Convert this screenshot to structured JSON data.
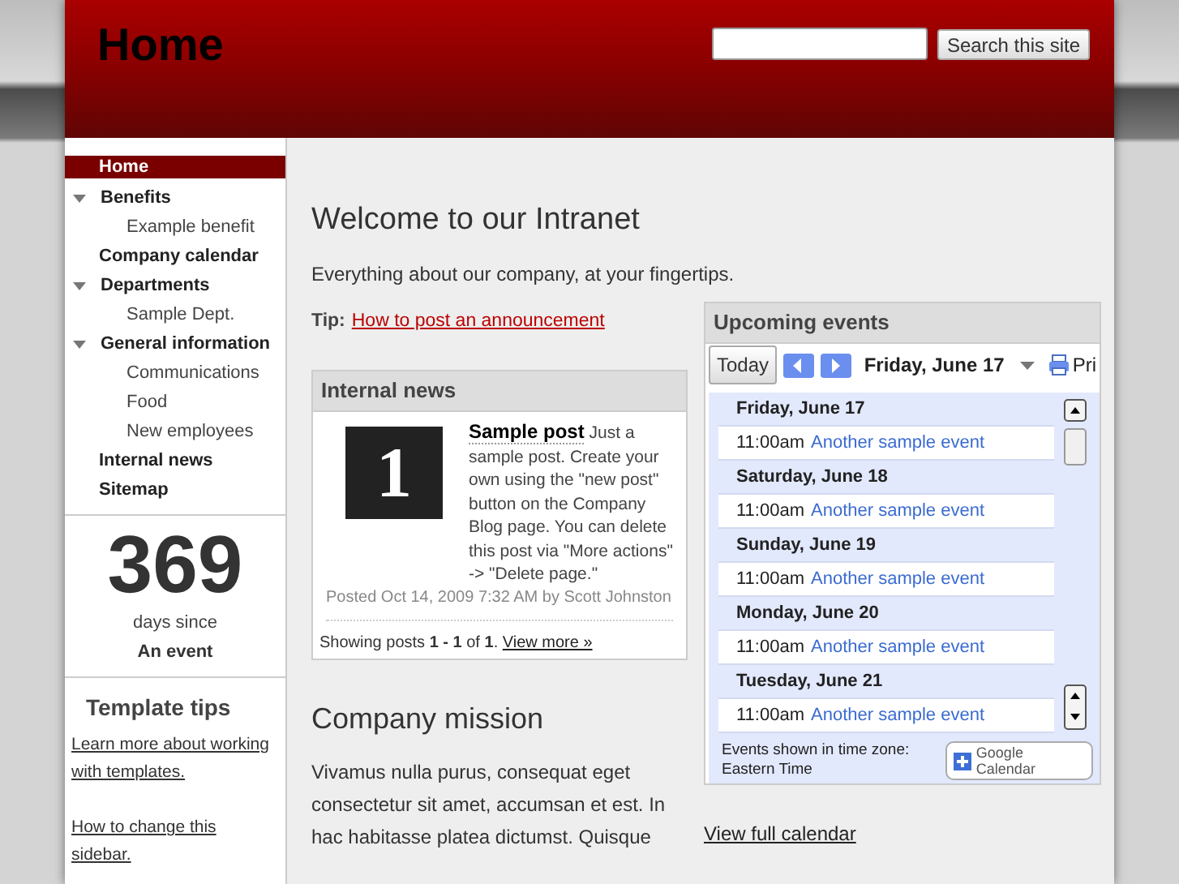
{
  "header": {
    "title": "Home",
    "search_button": "Search this site"
  },
  "sidebar": {
    "nav": [
      {
        "label": "Home",
        "selected": true
      },
      {
        "label": "Benefits",
        "selected": false,
        "expanded": true,
        "children": [
          {
            "label": "Example benefit",
            "selected": false
          }
        ]
      },
      {
        "label": "Company calendar",
        "selected": false
      },
      {
        "label": "Departments",
        "selected": false,
        "expanded": true,
        "children": [
          {
            "label": "Sample Dept.",
            "selected": false
          }
        ]
      },
      {
        "label": "General information",
        "selected": false,
        "expanded": true,
        "children": [
          {
            "label": "Communications",
            "selected": false
          },
          {
            "label": "Food",
            "selected": false
          },
          {
            "label": "New employees",
            "selected": false
          }
        ]
      },
      {
        "label": "Internal news",
        "selected": false
      },
      {
        "label": "Sitemap",
        "selected": false
      }
    ],
    "counter": {
      "number": "369",
      "caption": "days since",
      "event": "An event"
    },
    "tips": {
      "title": "Template tips",
      "links": [
        "Learn more about working with templates.",
        "How to change this sidebar."
      ]
    }
  },
  "main": {
    "heading": "Welcome to our Intranet",
    "intro": "Everything about our company, at your fingertips.",
    "tip": {
      "label": "Tip:",
      "link": "How to post an announcement"
    },
    "news": {
      "title": "Internal news",
      "post": {
        "image_text": "1",
        "title": "Sample post",
        "body": "Just a sample post. Create your own using the \"new post\" button on the Company Blog page. You can delete this post via \"More actions\" -> \"Delete page.\"",
        "meta": "Posted Oct 14, 2009 7:32 AM by Scott Johnston"
      },
      "summary": "Showing posts **1 - 1** of **1**.",
      "more_link": "View more »"
    },
    "mission": {
      "heading": "Company mission",
      "text": "Vivamus nulla purus, consequat eget consectetur sit amet, accumsan et est. In hac habitasse platea dictumst. Quisque"
    },
    "calendar": {
      "title": "Upcoming events",
      "today_button": "Today",
      "date": "Friday, June 17",
      "print": "Pri",
      "days": [
        {
          "date": "Friday, June 17",
          "events": [
            {
              "time": "11:00am",
              "title": "Another sample event"
            }
          ]
        },
        {
          "date": "Saturday, June 18",
          "events": [
            {
              "time": "11:00am",
              "title": "Another sample event"
            }
          ]
        },
        {
          "date": "Sunday, June 19",
          "events": [
            {
              "time": "11:00am",
              "title": "Another sample event"
            }
          ]
        },
        {
          "date": "Monday, June 20",
          "events": [
            {
              "time": "11:00am",
              "title": "Another sample event"
            }
          ]
        },
        {
          "date": "Tuesday, June 21",
          "events": [
            {
              "time": "11:00am",
              "title": "Another sample event"
            }
          ]
        }
      ],
      "timezone": "Events shown in time zone: Eastern Time",
      "badge": "Google Calendar",
      "full_link": "View full calendar"
    }
  }
}
